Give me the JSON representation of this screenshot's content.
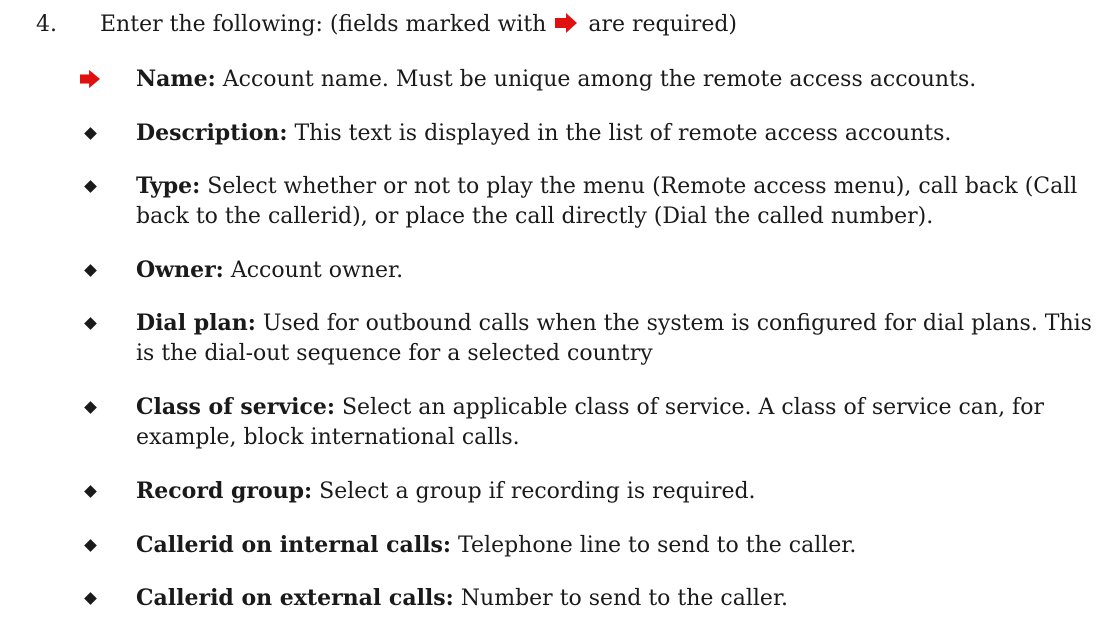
{
  "step": {
    "number": "4.",
    "text_before": "Enter the following: (fields marked with",
    "text_after": "are required)",
    "required_icon": "red-arrow-icon"
  },
  "fields": [
    {
      "label": "Name:",
      "text": "Account name. Must be unique among the remote access accounts.",
      "bullet": "red-arrow-icon"
    },
    {
      "label": "Description:",
      "text": "This text is displayed in the list of remote access accounts.",
      "bullet": "diamond-icon"
    },
    {
      "label": "Type:",
      "text": "Select whether or not to play the menu (Remote access menu), call back (Call back to the callerid), or place the call directly (Dial the called number).",
      "bullet": "diamond-icon"
    },
    {
      "label": "Owner:",
      "text": "Account owner.",
      "bullet": "diamond-icon"
    },
    {
      "label": "Dial plan:",
      "text": "Used for outbound calls when the system is configured for dial plans. This is the dial-out sequence for a selected country",
      "bullet": "diamond-icon"
    },
    {
      "label": "Class of service:",
      "text": "Select an applicable class of service. A class of service can, for example, block international calls.",
      "bullet": "diamond-icon"
    },
    {
      "label": "Record group:",
      "text": "Select a group if recording is required.",
      "bullet": "diamond-icon"
    },
    {
      "label": "Callerid on internal calls:",
      "text": "Telephone line to send to the caller.",
      "bullet": "diamond-icon"
    },
    {
      "label": "Callerid on external calls:",
      "text": "Number to send to the caller.",
      "bullet": "diamond-icon"
    }
  ],
  "colors": {
    "required_arrow": "#e01010",
    "text": "#1a1a1a"
  }
}
